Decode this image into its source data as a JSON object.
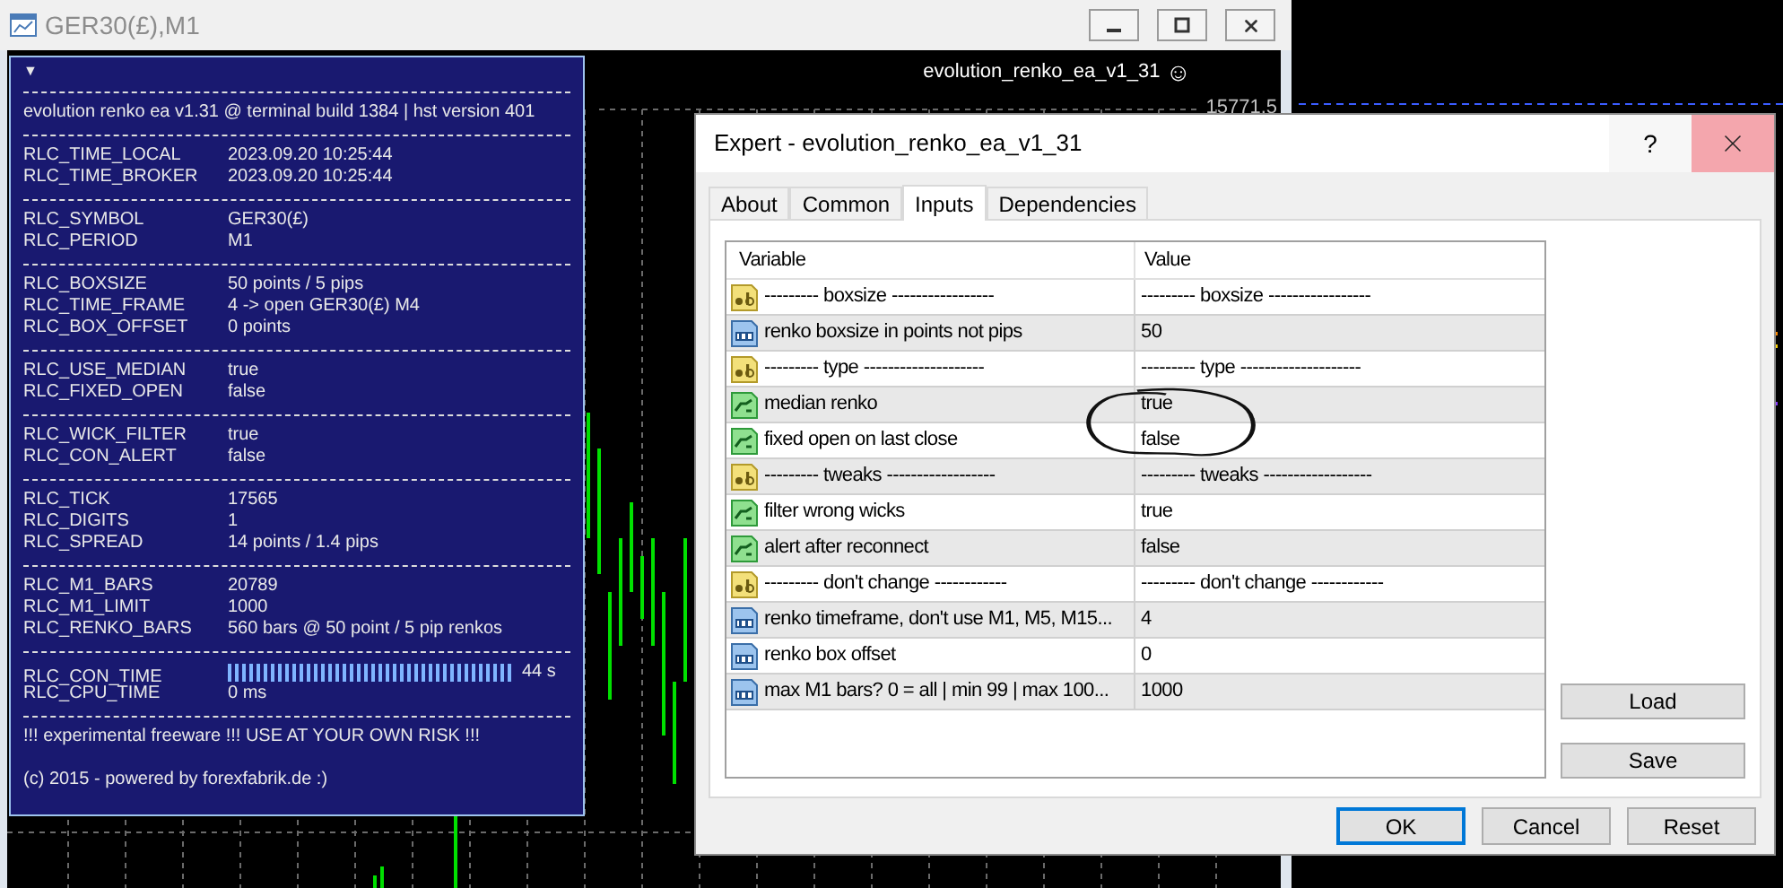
{
  "chart_window": {
    "title": "GER30(£),M1",
    "ea_label": "evolution_renko_ea_v1_31",
    "ea_status_icon": "☺",
    "price_label": "15771.5"
  },
  "info_panel": {
    "collapse_marker": "▼",
    "header": "evolution renko ea v1.31 @ terminal build 1384 | hst version 401",
    "sections": [
      [
        {
          "kind": "text",
          "name": "RLC_TIME_LOCAL",
          "value": "2023.09.20 10:25:44"
        },
        {
          "kind": "text",
          "name": "RLC_TIME_BROKER",
          "value": "2023.09.20 10:25:44"
        }
      ],
      [
        {
          "kind": "text",
          "name": "RLC_SYMBOL",
          "value": "GER30(£)"
        },
        {
          "kind": "text",
          "name": "RLC_PERIOD",
          "value": "M1"
        }
      ],
      [
        {
          "kind": "text",
          "name": "RLC_BOXSIZE",
          "value": "50 points / 5 pips"
        },
        {
          "kind": "text",
          "name": "RLC_TIME_FRAME",
          "value": "4 -> open GER30(£) M4"
        },
        {
          "kind": "text",
          "name": "RLC_BOX_OFFSET",
          "value": "0 points"
        }
      ],
      [
        {
          "kind": "text",
          "name": "RLC_USE_MEDIAN",
          "value": "true"
        },
        {
          "kind": "text",
          "name": "RLC_FIXED_OPEN",
          "value": "false"
        }
      ],
      [
        {
          "kind": "text",
          "name": "RLC_WICK_FILTER",
          "value": "true"
        },
        {
          "kind": "text",
          "name": "RLC_CON_ALERT",
          "value": "false"
        }
      ],
      [
        {
          "kind": "text",
          "name": "RLC_TICK",
          "value": "17565"
        },
        {
          "kind": "text",
          "name": "RLC_DIGITS",
          "value": "1"
        },
        {
          "kind": "text",
          "name": "RLC_SPREAD",
          "value": "14 points / 1.4 pips"
        }
      ],
      [
        {
          "kind": "text",
          "name": "RLC_M1_BARS",
          "value": "20789"
        },
        {
          "kind": "text",
          "name": "RLC_M1_LIMIT",
          "value": "1000"
        },
        {
          "kind": "text",
          "name": "RLC_RENKO_BARS",
          "value": "560 bars @ 50 point / 5 pip renkos"
        }
      ],
      [
        {
          "kind": "meter",
          "name": "RLC_CON_TIME",
          "level": 1,
          "reading": "44 s"
        },
        {
          "kind": "text",
          "name": "RLC_CPU_TIME",
          "value": "0 ms"
        }
      ]
    ],
    "warning": "!!! experimental freeware !!! USE AT YOUR OWN RISK !!!",
    "footer": "(c) 2015 - powered by forexfabrik.de :)"
  },
  "dialog": {
    "title": "Expert - evolution_renko_ea_v1_31",
    "help": "?",
    "tabs": [
      {
        "label": "About",
        "selected": false
      },
      {
        "label": "Common",
        "selected": false
      },
      {
        "label": "Inputs",
        "selected": true
      },
      {
        "label": "Dependencies",
        "selected": false
      }
    ],
    "columns": [
      "Variable",
      "Value"
    ],
    "rows": [
      {
        "kind": "string",
        "variable": "--------- boxsize -----------------",
        "value": "--------- boxsize -----------------"
      },
      {
        "kind": "int",
        "variable": "renko boxsize in points not pips",
        "value": "50"
      },
      {
        "kind": "string",
        "variable": "--------- type --------------------",
        "value": "--------- type --------------------"
      },
      {
        "kind": "bool",
        "variable": "median renko",
        "value": "true"
      },
      {
        "kind": "bool",
        "variable": "fixed open on last close",
        "value": "false"
      },
      {
        "kind": "string",
        "variable": "--------- tweaks ------------------",
        "value": "--------- tweaks ------------------"
      },
      {
        "kind": "bool",
        "variable": "filter wrong wicks",
        "value": "true"
      },
      {
        "kind": "bool",
        "variable": "alert after reconnect",
        "value": "false"
      },
      {
        "kind": "string",
        "variable": "--------- don't change ------------",
        "value": "--------- don't change ------------"
      },
      {
        "kind": "int",
        "variable": "renko timeframe, don't use M1, M5, M15...",
        "value": "4"
      },
      {
        "kind": "int",
        "variable": "renko box offset",
        "value": "0"
      },
      {
        "kind": "int",
        "variable": "max M1 bars? 0 = all | min 99 | max 100...",
        "value": "1000"
      }
    ],
    "side_buttons": [
      "Load",
      "Save"
    ],
    "buttons": [
      {
        "label": "OK",
        "default": true
      },
      {
        "label": "Cancel",
        "default": false
      },
      {
        "label": "Reset",
        "default": false
      }
    ]
  }
}
